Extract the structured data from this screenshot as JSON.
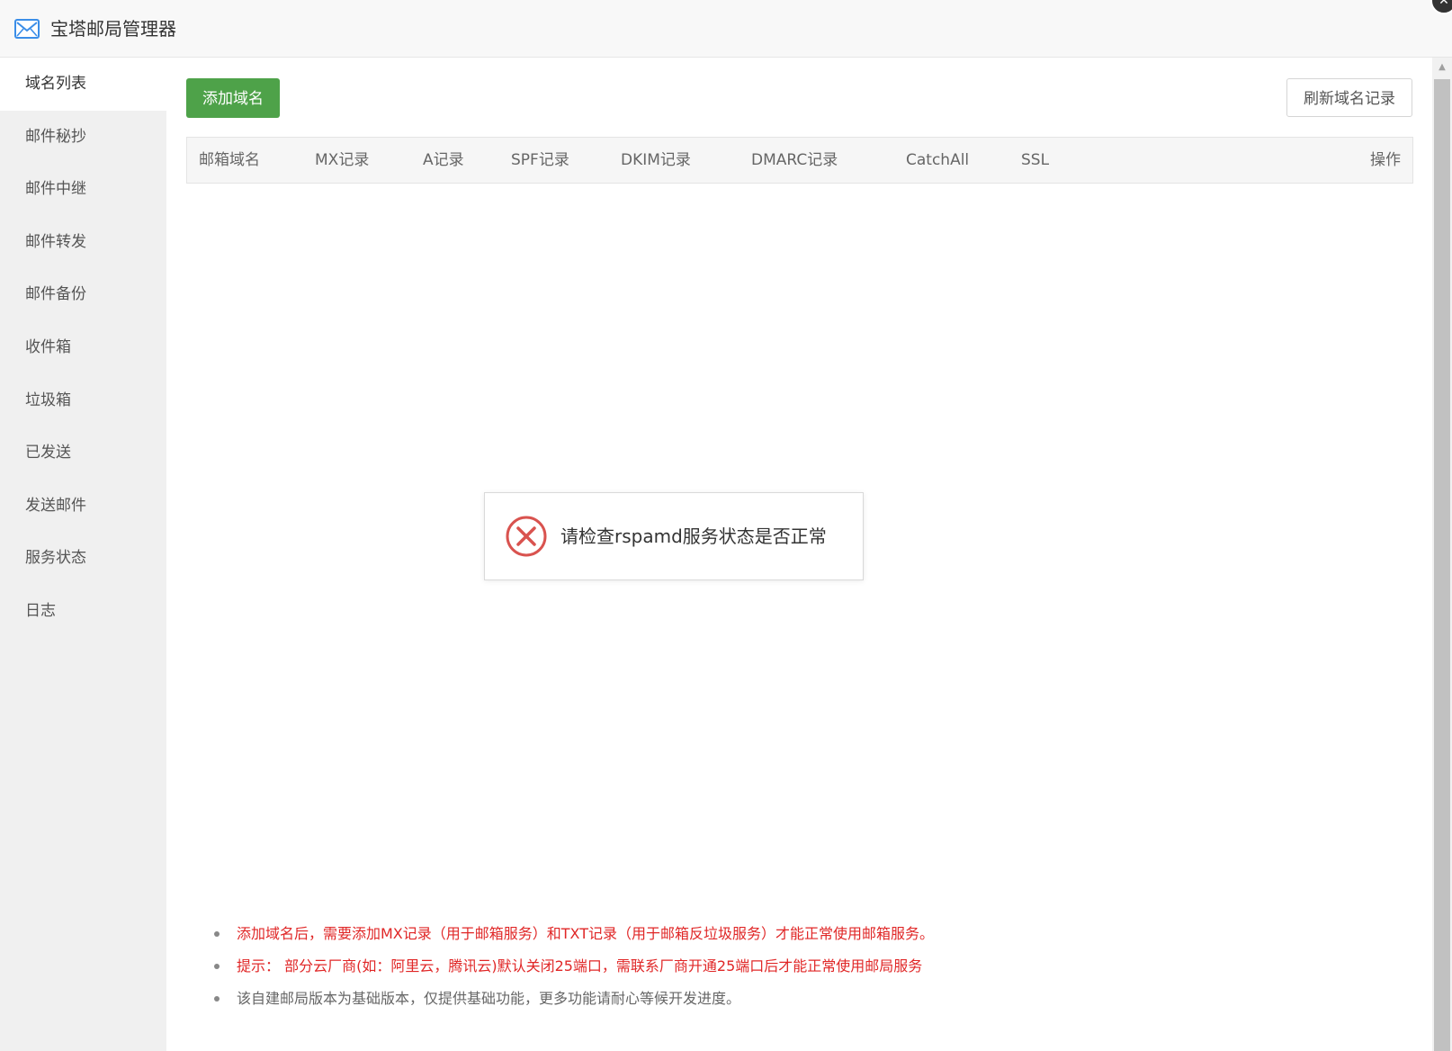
{
  "window": {
    "title": "宝塔邮局管理器"
  },
  "sidebar": {
    "items": [
      {
        "label": "域名列表",
        "active": true
      },
      {
        "label": "邮件秘抄"
      },
      {
        "label": "邮件中继"
      },
      {
        "label": "邮件转发"
      },
      {
        "label": "邮件备份"
      },
      {
        "label": "收件箱"
      },
      {
        "label": "垃圾箱"
      },
      {
        "label": "已发送"
      },
      {
        "label": "发送邮件"
      },
      {
        "label": "服务状态"
      },
      {
        "label": "日志"
      }
    ]
  },
  "toolbar": {
    "add_label": "添加域名",
    "refresh_label": "刷新域名记录"
  },
  "table": {
    "columns": [
      "邮箱域名",
      "MX记录",
      "A记录",
      "SPF记录",
      "DKIM记录",
      "DMARC记录",
      "CatchAll",
      "SSL",
      "操作"
    ]
  },
  "toast": {
    "message": "请检查rspamd服务状态是否正常"
  },
  "notes": [
    "添加域名后，需要添加MX记录（用于邮箱服务）和TXT记录（用于邮箱反垃圾服务）才能正常使用邮箱服务。",
    "提示： 部分云厂商(如：阿里云，腾讯云)默认关闭25端口，需联系厂商开通25端口后才能正常使用邮局服务",
    "该自建邮局版本为基础版本，仅提供基础功能，更多功能请耐心等候开发进度。"
  ],
  "colors": {
    "primary_green": "#4ea249",
    "note_red": "#e02727",
    "error_icon": "#d9534f",
    "app_icon_blue": "#3b8ee8"
  },
  "icons": {
    "app": "mail-icon",
    "close": "close-icon",
    "toast": "error-circle-icon"
  }
}
